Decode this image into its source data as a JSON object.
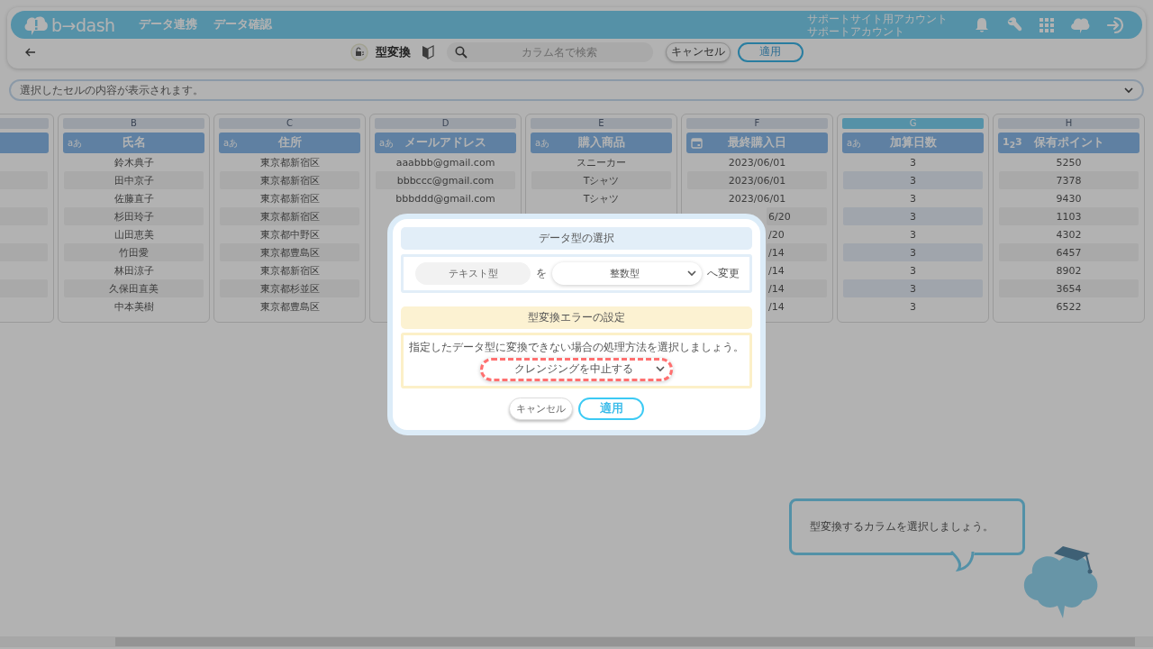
{
  "header": {
    "logo": "b→dash",
    "nav": [
      {
        "label": "データ連携"
      },
      {
        "label": "データ確認"
      }
    ],
    "account": {
      "site": "サポートサイト用アカウント",
      "user": "サポートアカウント"
    }
  },
  "toolbar": {
    "title": "型変換",
    "search": {
      "placeholder": "カラム名で検索"
    },
    "buttons": [
      {
        "label": "キャンセル",
        "kind": "secondary"
      },
      {
        "label": "適用",
        "kind": "primary"
      }
    ]
  },
  "cell_preview": {
    "placeholder": "選択したセルの内容が表示されます。"
  },
  "table": {
    "columns": [
      {
        "letter": "B",
        "name": "氏名",
        "kind": "text",
        "type_mark": "aあ",
        "selected": false,
        "cells": [
          "鈴木典子",
          "田中京子",
          "佐藤直子",
          "杉田玲子",
          "山田恵美",
          "竹田愛",
          "林田涼子",
          "久保田直美",
          "中本美樹"
        ]
      },
      {
        "letter": "C",
        "name": "住所",
        "kind": "text",
        "type_mark": "aあ",
        "selected": false,
        "cells": [
          "東京都新宿区",
          "東京都新宿区",
          "東京都新宿区",
          "東京都新宿区",
          "東京都中野区",
          "東京都豊島区",
          "東京都新宿区",
          "東京都杉並区",
          "東京都豊島区"
        ]
      },
      {
        "letter": "D",
        "name": "メールアドレス",
        "kind": "text",
        "type_mark": "aあ",
        "selected": false,
        "cells": [
          "aaabbb@gmail.com",
          "bbbccc@gmail.com",
          "bbbddd@gmail.com"
        ]
      },
      {
        "letter": "E",
        "name": "購入商品",
        "kind": "text",
        "type_mark": "aあ",
        "selected": false,
        "cells": [
          "スニーカー",
          "Tシャツ",
          "Tシャツ"
        ]
      },
      {
        "letter": "F",
        "name": "最終購入日",
        "kind": "date",
        "selected": false,
        "cells": [
          {
            "text": "2023/06/01",
            "covered": false
          },
          {
            "text": "2023/06/01",
            "covered": false
          },
          {
            "text": "2023/06/01",
            "covered": false
          },
          {
            "text": "6/20",
            "covered": true
          },
          {
            "text": "/20",
            "covered": true
          },
          {
            "text": "/14",
            "covered": true
          },
          {
            "text": "/14",
            "covered": true
          },
          {
            "text": "/14",
            "covered": true
          },
          {
            "text": "/14",
            "covered": true
          }
        ]
      },
      {
        "letter": "G",
        "name": "加算日数",
        "kind": "text",
        "type_mark": "aあ",
        "selected": true,
        "cells": [
          "3",
          "3",
          "3",
          "3",
          "3",
          "3",
          "3",
          "3",
          "3"
        ]
      },
      {
        "letter": "H",
        "name": "保有ポイント",
        "kind": "number",
        "type_mark": "1$_{2}$3",
        "selected": false,
        "cells": [
          "5250",
          "7378",
          "9430",
          "1103",
          "4302",
          "6457",
          "8902",
          "3654",
          "6522"
        ]
      }
    ]
  },
  "dialog": {
    "type_section": {
      "title": "データ型の選択",
      "from": "テキスト型",
      "particle": "を",
      "to": "整数型",
      "suffix": "へ変更"
    },
    "error_section": {
      "title": "型変換エラーの設定",
      "description": "指定したデータ型に変換できない場合の処理方法を選択しましょう。",
      "action": "クレンジングを中止する",
      "highlighted": true
    },
    "buttons": [
      {
        "label": "キャンセル",
        "kind": "secondary"
      },
      {
        "label": "適用",
        "kind": "primary"
      }
    ]
  },
  "hint": {
    "text": "型変換するカラムを選択しましょう。"
  }
}
